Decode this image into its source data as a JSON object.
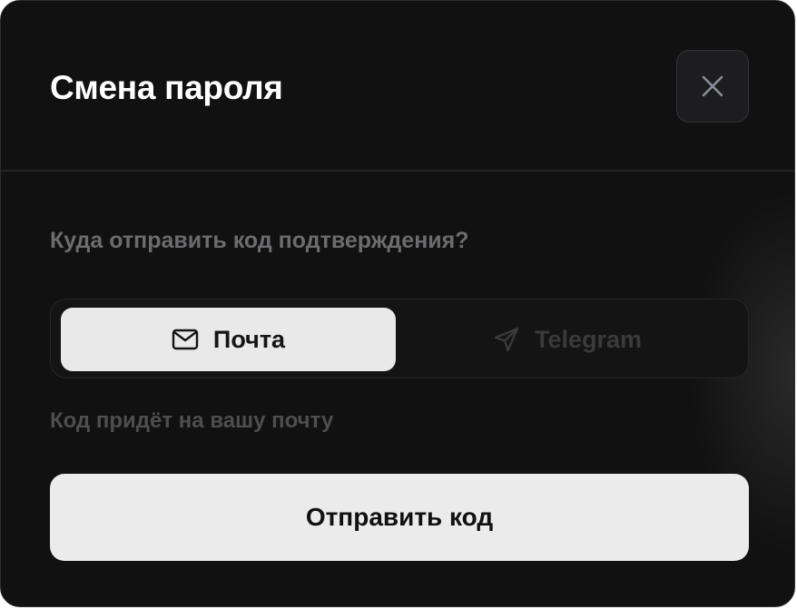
{
  "dialog": {
    "title": "Смена пароля",
    "question": "Куда отправить код подтверждения?",
    "channels": [
      {
        "label": "Почта",
        "icon": "mail-icon",
        "selected": true
      },
      {
        "label": "Telegram",
        "icon": "send-icon",
        "selected": false
      }
    ],
    "hint": "Код придёт на вашу почту",
    "submit_label": "Отправить код"
  },
  "colors": {
    "background": "#111111",
    "selected_segment": "#e9e9e9",
    "primary_button": "#ebebeb",
    "muted_text": "#6c6c6e"
  }
}
